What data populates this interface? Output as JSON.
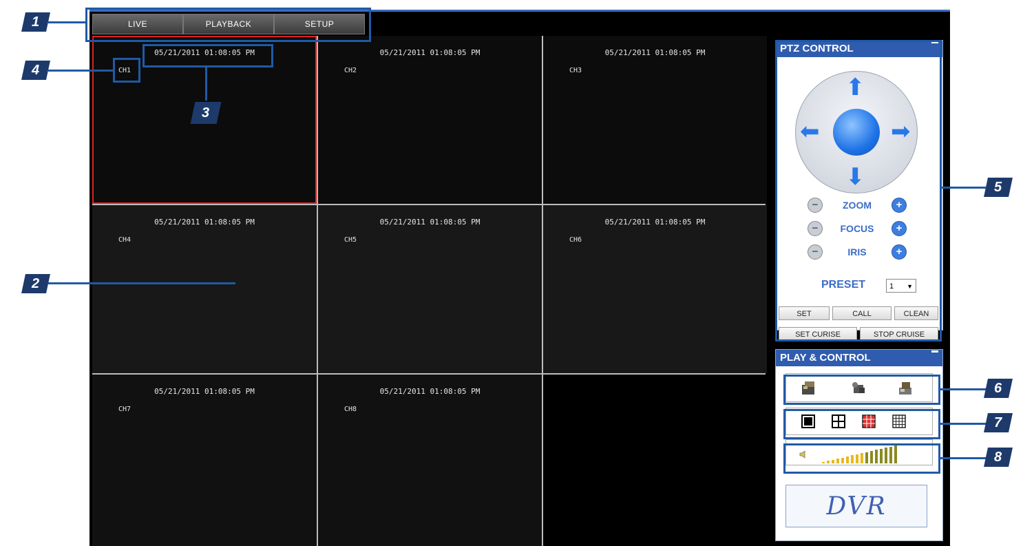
{
  "tabs": [
    "LIVE",
    "PLAYBACK",
    "SETUP"
  ],
  "channels": [
    {
      "timestamp": "05/21/2011 01:08:05 PM",
      "label": "CH1"
    },
    {
      "timestamp": "05/21/2011 01:08:05 PM",
      "label": "CH2"
    },
    {
      "timestamp": "05/21/2011 01:08:05 PM",
      "label": "CH3"
    },
    {
      "timestamp": "05/21/2011 01:08:05 PM",
      "label": "CH4"
    },
    {
      "timestamp": "05/21/2011 01:08:05 PM",
      "label": "CH5"
    },
    {
      "timestamp": "05/21/2011 01:08:05 PM",
      "label": "CH6"
    },
    {
      "timestamp": "05/21/2011 01:08:05 PM",
      "label": "CH7"
    },
    {
      "timestamp": "05/21/2011 01:08:05 PM",
      "label": "CH8"
    }
  ],
  "ptz": {
    "title": "PTZ CONTROL",
    "zoom": "ZOOM",
    "focus": "FOCUS",
    "iris": "IRIS",
    "preset_label": "PRESET",
    "preset_value": "1",
    "set": "SET",
    "call": "CALL",
    "clean": "CLEAN",
    "set_cruise": "SET CURISE",
    "stop_cruise": "STOP CRUISE"
  },
  "play": {
    "title": "PLAY & CONTROL",
    "logo": "DVR"
  },
  "callouts": [
    "1",
    "2",
    "3",
    "4",
    "5",
    "6",
    "7",
    "8"
  ],
  "colors": {
    "accent": "#2f5cae",
    "callout": "#1d3a6b",
    "selected_border": "#dd2222"
  }
}
